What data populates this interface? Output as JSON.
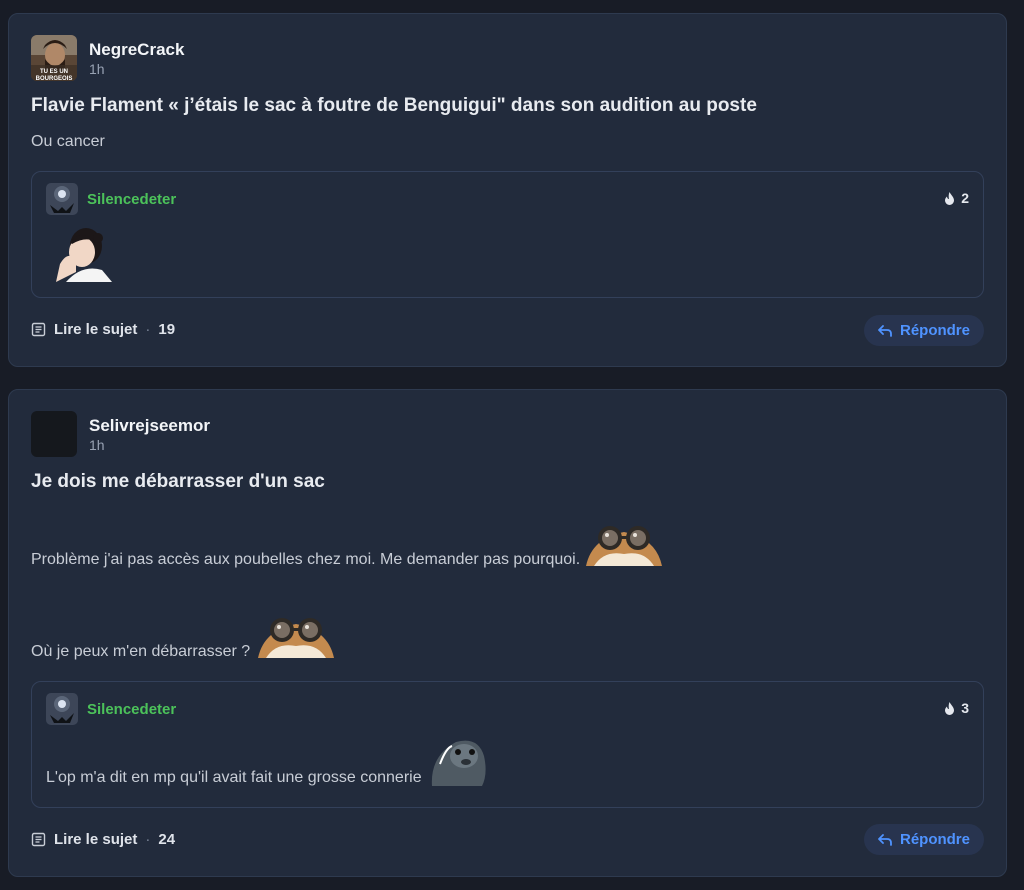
{
  "posts": [
    {
      "author": "NegreCrack",
      "avatar_caption": "TU ES UN BOURGEOIS",
      "time": "1h",
      "title": "Flavie Flament « j’étais le sac à foutre de Benguigui\" dans son audition au poste",
      "body": [
        "Ou cancer"
      ],
      "reply": {
        "author": "Silencedeter",
        "reactions": "2",
        "text": ""
      },
      "read_label": "Lire le sujet",
      "comments": "19",
      "reply_label": "Répondre"
    },
    {
      "author": "Selivrejseemor",
      "time": "1h",
      "title": "Je dois me débarrasser d'un sac",
      "body": [
        "Problème j'ai pas accès aux poubelles chez moi. Me demander pas pourquoi.",
        "Où je peux m'en débarrasser ?"
      ],
      "reply": {
        "author": "Silencedeter",
        "reactions": "3",
        "text": "L'op m'a dit en mp qu'il avait fait une grosse connerie"
      },
      "read_label": "Lire le sujet",
      "comments": "24",
      "reply_label": "Répondre"
    }
  ],
  "icons": {
    "reaction": "fire-icon",
    "read": "document-icon",
    "reply": "reply-arrow-icon"
  },
  "colors": {
    "accent": "#4f93ff",
    "reply_author": "#4cc25a",
    "card_bg": "#222b3c"
  }
}
